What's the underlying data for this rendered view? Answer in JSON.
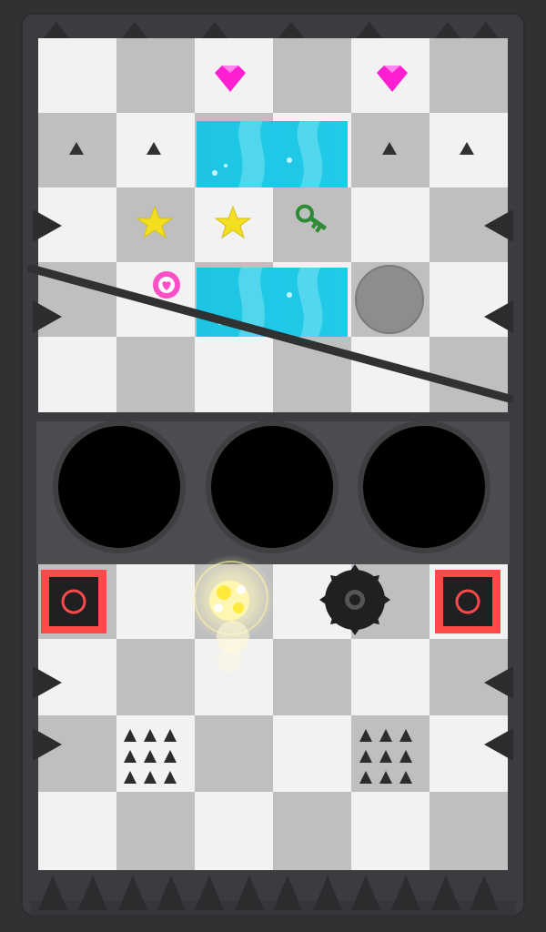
{
  "game": {
    "board_columns": 6,
    "upper_board_rows": 5,
    "lower_board_rows": 4,
    "hole_count": 3,
    "pickups": [
      {
        "type": "gem",
        "icon": "pink-gem-icon",
        "color": "#ff1fd2"
      },
      {
        "type": "gem",
        "icon": "pink-gem-icon",
        "color": "#ff1fd2"
      },
      {
        "type": "star",
        "icon": "star-icon",
        "color": "#f3df1f"
      },
      {
        "type": "star",
        "icon": "star-icon",
        "color": "#f3df1f"
      },
      {
        "type": "key",
        "icon": "key-icon",
        "color": "#2f8a34"
      },
      {
        "type": "heart-ring",
        "icon": "heart-ring-icon",
        "color": "#ff4fc8"
      }
    ],
    "hazards": {
      "spike_clusters": 2,
      "rolling_saw": 1,
      "launchers": 2,
      "floor_triangles": 4
    },
    "colors": {
      "frame": "#303234",
      "board_light": "#f2f2f2",
      "board_dark": "#bfbfbf",
      "water": "#1fc7e6",
      "hole": "#000000",
      "launcher_red": "#ff4a4a",
      "ball_glow": "#ffe96a"
    }
  }
}
